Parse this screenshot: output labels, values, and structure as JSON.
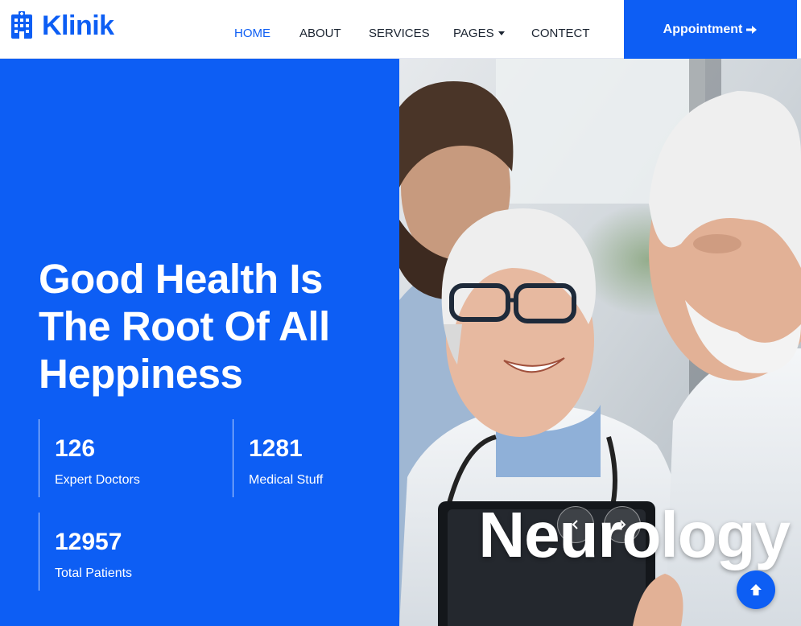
{
  "brand": {
    "name": "Klinik",
    "icon": "hospital-icon",
    "color": "#0d5ef4"
  },
  "nav": {
    "items": [
      {
        "label": "HOME",
        "active": true
      },
      {
        "label": "ABOUT"
      },
      {
        "label": "SERVICES"
      },
      {
        "label": "PAGES",
        "dropdown": true
      },
      {
        "label": "CONTECT"
      }
    ],
    "appointment": {
      "label": "Appointment",
      "icon": "arrow-right-icon"
    }
  },
  "hero": {
    "title": "Good Health Is The Root Of All Heppiness",
    "stats": [
      {
        "number": "126",
        "label": "Expert Doctors"
      },
      {
        "number": "1281",
        "label": "Medical Stuff"
      },
      {
        "number": "12957",
        "label": "Total Patients"
      }
    ],
    "slide_caption": "Neurology",
    "background_color": "#0d5ef4"
  },
  "icons": {
    "prev": "chevron-left-icon",
    "next": "chevron-right-icon",
    "back_to_top": "arrow-up-icon"
  }
}
